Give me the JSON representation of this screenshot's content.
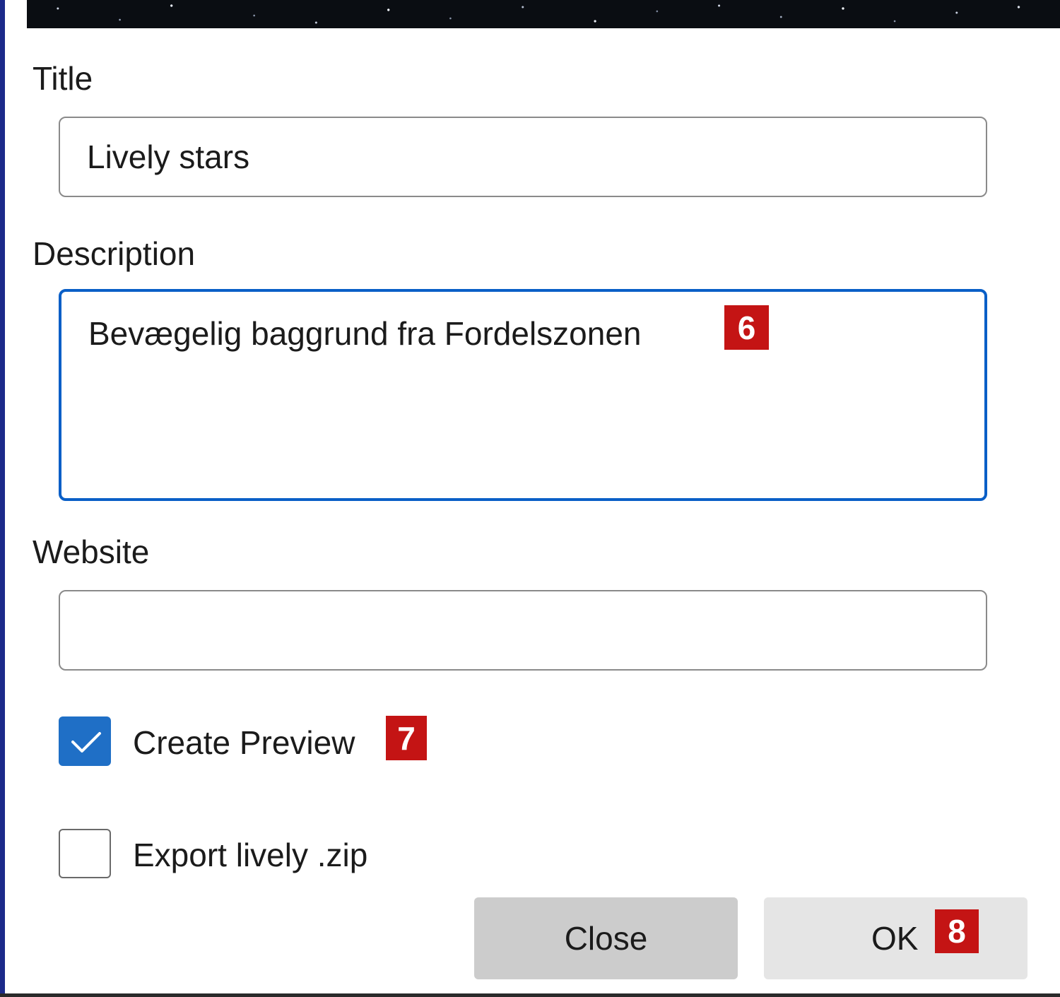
{
  "dialog": {
    "title_label": "Title",
    "title_value": "Lively stars",
    "description_label": "Description",
    "description_value": "Bevægelig baggrund fra Fordelszonen",
    "website_label": "Website",
    "website_value": "",
    "create_preview": {
      "label": "Create Preview",
      "checked": true
    },
    "export_zip": {
      "label": "Export lively .zip",
      "checked": false
    },
    "close_label": "Close",
    "ok_label": "OK"
  },
  "markers": {
    "description": "6",
    "create_preview": "7",
    "ok": "8"
  },
  "colors": {
    "accent": "#0a5fc7",
    "checkbox_fill": "#1f6fc6",
    "marker": "#c41414",
    "close_button": "#cccccc",
    "ok_button": "#e5e5e5"
  }
}
